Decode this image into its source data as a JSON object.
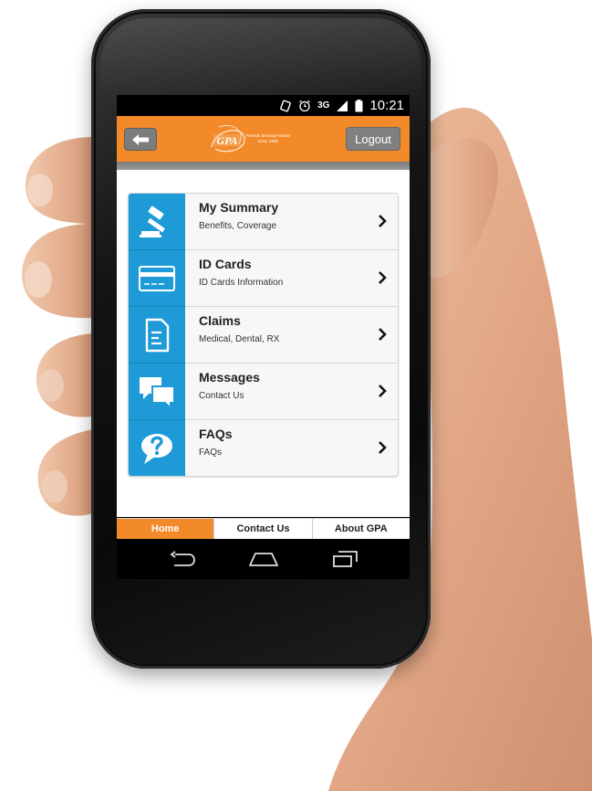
{
  "status_bar": {
    "network": "3G",
    "time": "10:21"
  },
  "header": {
    "logo_text": "GPA",
    "logo_tagline_1": "Friends Serving Friends",
    "logo_tagline_2": "since 1980",
    "logout_label": "Logout"
  },
  "menu": {
    "items": [
      {
        "title": "My Summary",
        "subtitle": "Benefits, Coverage",
        "icon": "gavel-icon"
      },
      {
        "title": "ID Cards",
        "subtitle": "ID Cards Information",
        "icon": "credit-card-icon"
      },
      {
        "title": "Claims",
        "subtitle": "Medical, Dental, RX",
        "icon": "document-icon"
      },
      {
        "title": "Messages",
        "subtitle": "Contact Us",
        "icon": "chat-bubbles-icon"
      },
      {
        "title": "FAQs",
        "subtitle": "FAQs",
        "icon": "question-bubble-icon"
      }
    ]
  },
  "bottom_nav": {
    "tabs": [
      {
        "label": "Home",
        "active": true
      },
      {
        "label": "Contact Us",
        "active": false
      },
      {
        "label": "About GPA",
        "active": false
      }
    ]
  },
  "colors": {
    "brand_orange": "#f28a2a",
    "icon_blue": "#1e9ad6",
    "button_gray": "#808080"
  }
}
